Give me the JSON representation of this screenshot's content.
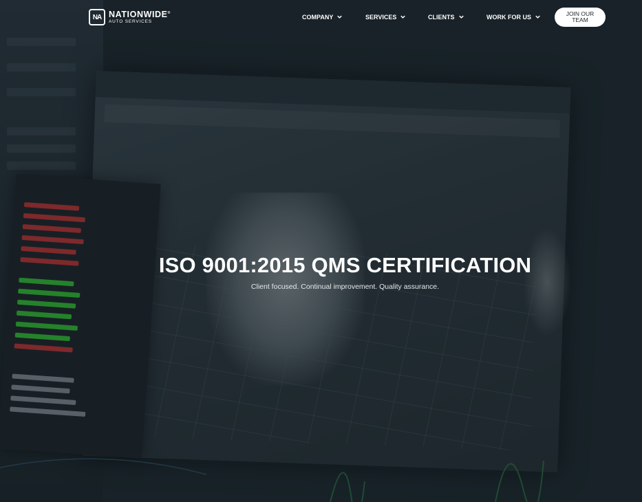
{
  "brand": {
    "logo_mark": "NA",
    "name": "NATIONWIDE",
    "trademark": "®",
    "tagline": "AUTO SERVICES"
  },
  "nav": {
    "items": [
      {
        "label": "COMPANY",
        "icon": "chevron-down-icon"
      },
      {
        "label": "SERVICES",
        "icon": "chevron-down-icon"
      },
      {
        "label": "CLIENTS",
        "icon": "chevron-down-icon"
      },
      {
        "label": "WORK FOR US",
        "icon": "chevron-down-icon"
      }
    ],
    "cta_label": "JOIN OUR TEAM"
  },
  "hero": {
    "title": "ISO 9001:2015 QMS CERTIFICATION",
    "subtitle": "Client focused. Continual improvement. Quality assurance."
  },
  "colors": {
    "overlay": "#1c272d",
    "text": "#ffffff",
    "button_bg": "#ffffff",
    "button_text": "#1b2328"
  }
}
